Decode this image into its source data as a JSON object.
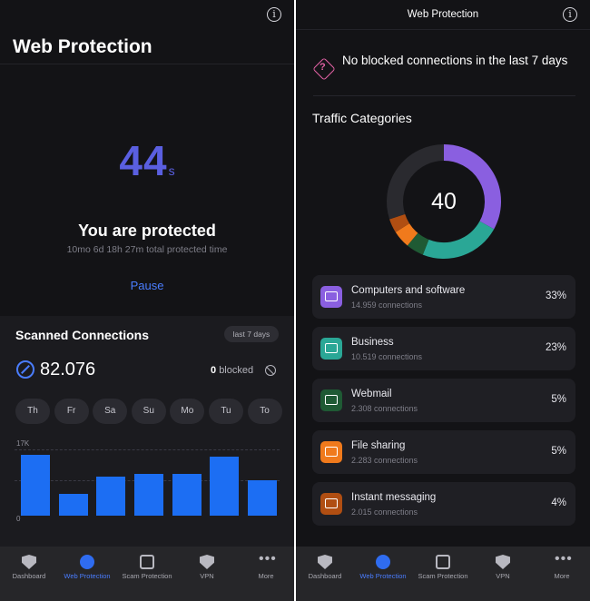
{
  "left": {
    "title": "Web Protection",
    "timer": {
      "value": "44",
      "unit": "s"
    },
    "status": "You are protected",
    "protected_time": "10mo 6d 18h 27m total protected time",
    "pause_label": "Pause",
    "scanned": {
      "title": "Scanned Connections",
      "badge": "last 7 days",
      "count": "82.076",
      "blocked_num": "0",
      "blocked_label": "blocked",
      "days": [
        "Th",
        "Fr",
        "Sa",
        "Su",
        "Mo",
        "Tu",
        "To"
      ],
      "y_max_label": "17K",
      "y_min_label": "0"
    }
  },
  "right": {
    "title": "Web Protection",
    "no_blocked": "No blocked connections in the last 7 days",
    "traffic_title": "Traffic Categories",
    "donut_total": "40",
    "categories": [
      {
        "name": "Computers and software",
        "connections": "14.959 connections",
        "percent": "33%",
        "color": "#8a5fe0"
      },
      {
        "name": "Business",
        "connections": "10.519 connections",
        "percent": "23%",
        "color": "#2aa796"
      },
      {
        "name": "Webmail",
        "connections": "2.308 connections",
        "percent": "5%",
        "color": "#1f5a34"
      },
      {
        "name": "File sharing",
        "connections": "2.283 connections",
        "percent": "5%",
        "color": "#f07a1c"
      },
      {
        "name": "Instant messaging",
        "connections": "2.015 connections",
        "percent": "4%",
        "color": "#b04e12"
      }
    ]
  },
  "tabs": [
    {
      "label": "Dashboard",
      "icon": "shield-icon"
    },
    {
      "label": "Web Protection",
      "icon": "globe-icon",
      "active": true
    },
    {
      "label": "Scam Protection",
      "icon": "scam-icon"
    },
    {
      "label": "VPN",
      "icon": "vpn-shield-icon"
    },
    {
      "label": "More",
      "icon": "more-icon"
    }
  ],
  "chart_data": [
    {
      "type": "bar",
      "categories": [
        "Th",
        "Fr",
        "Sa",
        "Su",
        "Mo",
        "Tu",
        "To"
      ],
      "values": [
        15600,
        5600,
        10000,
        10600,
        10600,
        15100,
        9100
      ],
      "ylabel": "",
      "ylim": [
        0,
        17000
      ],
      "y_tick_labels": [
        "0",
        "17K"
      ],
      "grid": true
    },
    {
      "type": "pie",
      "categories": [
        "Computers and software",
        "Business",
        "Webmail",
        "File sharing",
        "Instant messaging",
        "Other"
      ],
      "values": [
        33,
        23,
        5,
        5,
        4,
        30
      ],
      "title": "Traffic Categories",
      "center_label": "40"
    }
  ],
  "colors": {
    "accent": "#4a7dff",
    "timer": "#5a5fe0",
    "bar": "#1c6ef3",
    "donut_rest": "#2a2a2f"
  }
}
